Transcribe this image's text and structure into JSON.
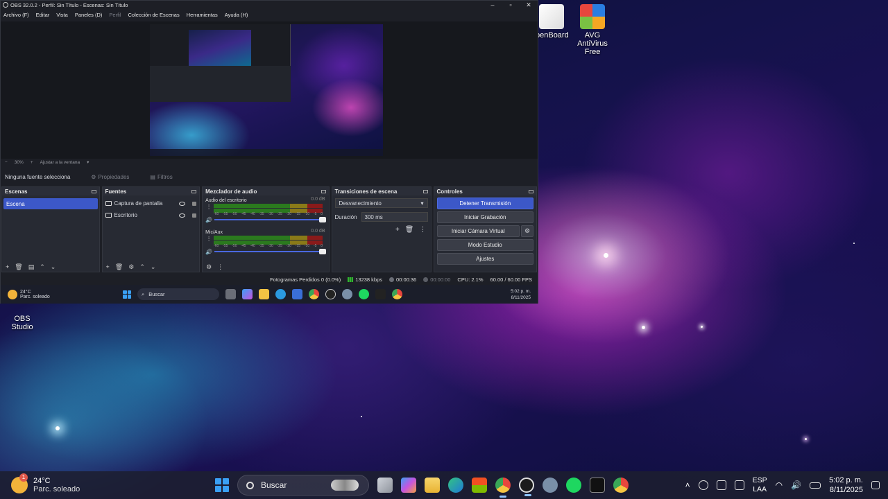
{
  "desktop": {
    "icons": [
      {
        "label": "penBoard"
      },
      {
        "label": "AVG AntiVirus Free"
      },
      {
        "label": "OBS Studio"
      }
    ]
  },
  "obs": {
    "title": "OBS 32.0.2 - Perfil: Sin Título - Escenas: Sin Título",
    "menu": [
      "Archivo (F)",
      "Editar",
      "Vista",
      "Paneles (D)",
      "Perfil",
      "Colección de Escenas",
      "Herramientas",
      "Ayuda (H)"
    ],
    "zoom": {
      "minus": "−",
      "value": "30%",
      "plus": "+",
      "fit": "Ajustar a la ventana"
    },
    "source_bar": {
      "none_selected": "Ninguna fuente selecciona",
      "properties": "Propiedades",
      "filters": "Filtros"
    },
    "scenes": {
      "header": "Escenas",
      "items": [
        "Escena"
      ]
    },
    "sources": {
      "header": "Fuentes",
      "items": [
        "Captura de pantalla",
        "Escritorio"
      ]
    },
    "mixer": {
      "header": "Mezclador de audio",
      "channels": [
        {
          "name": "Audio del escritorio",
          "db": "0.0 dB"
        },
        {
          "name": "Mic/Aux",
          "db": "0.0 dB"
        }
      ],
      "ticks": [
        "-60",
        "-55",
        "-50",
        "-45",
        "-40",
        "-35",
        "-30",
        "-25",
        "-20",
        "-15",
        "-10",
        "-5",
        "0"
      ]
    },
    "transitions": {
      "header": "Transiciones de escena",
      "selected": "Desvanecimiento",
      "duration_label": "Duración",
      "duration_value": "300 ms"
    },
    "controls": {
      "header": "Controles",
      "stop_stream": "Detener Transmisión",
      "start_recording": "Iniciar Grabación",
      "virtual_camera": "Iniciar Cámara Virtual",
      "studio_mode": "Modo Estudio",
      "settings": "Ajustes"
    },
    "status": {
      "dropped": "Fotogramas Perdidos 0 (0.0%)",
      "bitrate": "13238 kbps",
      "stream_time": "00:00:36",
      "rec_time": "00:00:00",
      "cpu": "CPU: 2.1%",
      "fps": "60.00 / 60.00 FPS"
    },
    "inner_taskbar": {
      "temp": "24°C",
      "cond": "Parc. soleado",
      "search": "Buscar",
      "time": "5:02 p. m.",
      "date": "8/11/2025"
    }
  },
  "taskbar": {
    "temp": "24°C",
    "cond": "Parc. soleado",
    "badge": "1",
    "search_placeholder": "Buscar",
    "lang": "ESP",
    "lang2": "LAA",
    "time": "5:02 p. m.",
    "date": "8/11/2025"
  },
  "colors": {
    "accent": "#3c58c8",
    "panel": "#272a33",
    "window": "#1d1f26"
  }
}
